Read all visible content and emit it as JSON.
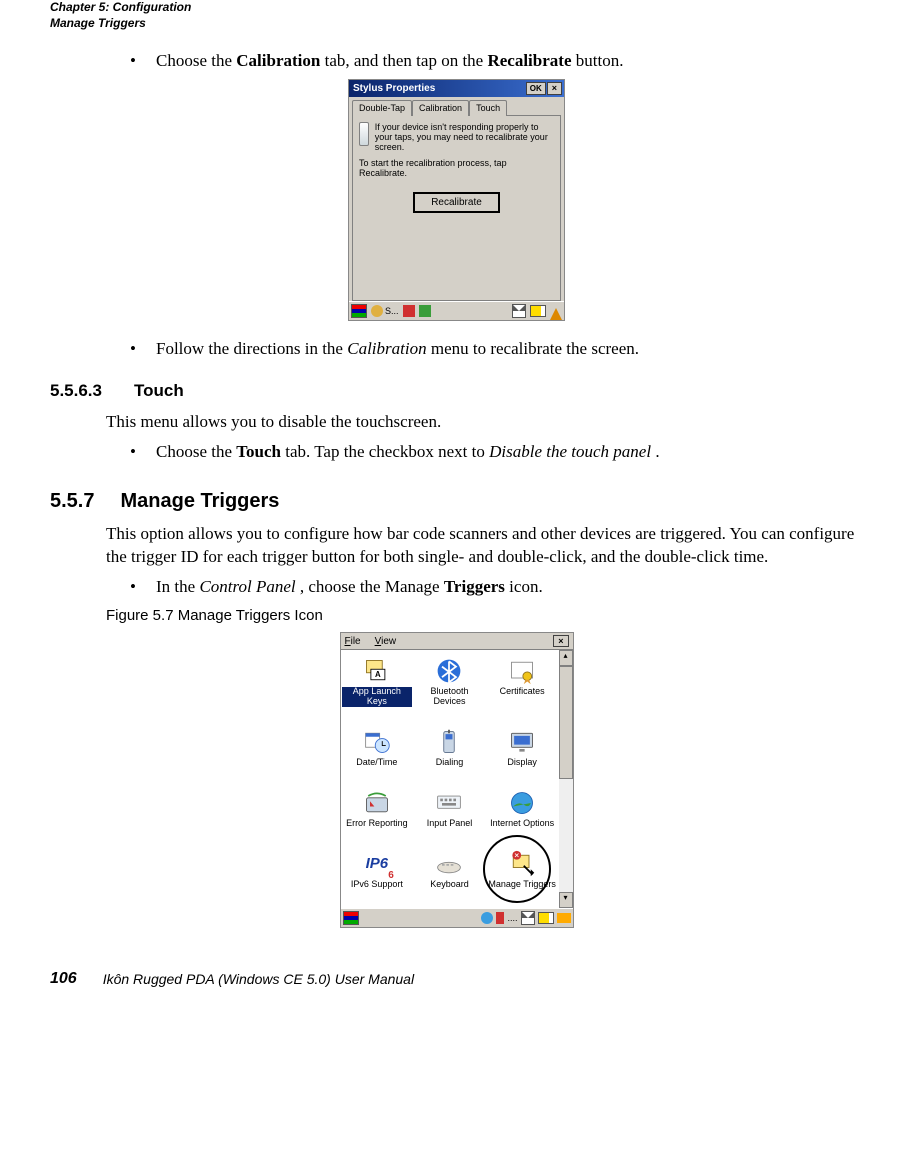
{
  "header": {
    "line1": "Chapter 5: Configuration",
    "line2": "Manage Triggers"
  },
  "bullet1_pre": "Choose the ",
  "bullet1_b1": "Calibration",
  "bullet1_mid": " tab, and then tap on the ",
  "bullet1_b2": "Recalibrate",
  "bullet1_post": " button.",
  "stylus": {
    "title": "Stylus Properties",
    "ok": "OK",
    "close": "×",
    "tab1": "Double-Tap",
    "tab2": "Calibration",
    "tab3": "Touch",
    "msg1": "If your device isn't responding properly to your taps, you may need to recalibrate your screen.",
    "msg2": "To start the recalibration process, tap Recalibrate.",
    "btn": "Recalibrate",
    "task_s": "S..."
  },
  "bullet2_pre": "Follow the directions in the ",
  "bullet2_em": "Calibration",
  "bullet2_post": " menu to recalibrate the screen.",
  "sec5563": {
    "num": "5.5.6.3",
    "title": "Touch"
  },
  "touch_body": "This menu allows you to disable the touchscreen.",
  "bullet3_pre": "Choose the ",
  "bullet3_b": "Touch",
  "bullet3_mid": " tab. Tap the checkbox next to ",
  "bullet3_em": "Disable the touch panel",
  "bullet3_post": ".",
  "sec557": {
    "num": "5.5.7",
    "title": "Manage Triggers"
  },
  "mt_body": "This option allows you to configure how bar code scanners and other devices are triggered. You can configure the trigger ID for each trigger button for both single- and double-click, and the double-click time.",
  "bullet4_pre": "In the ",
  "bullet4_em": "Control Panel",
  "bullet4_mid": ", choose the Manage ",
  "bullet4_b": "Triggers",
  "bullet4_post": " icon.",
  "figcap": "Figure 5.7  Manage Triggers Icon",
  "cp": {
    "file": "File",
    "view": "View",
    "close": "×",
    "items": [
      {
        "label": "App Launch Keys"
      },
      {
        "label": "Bluetooth Devices"
      },
      {
        "label": "Certificates"
      },
      {
        "label": "Date/Time"
      },
      {
        "label": "Dialing"
      },
      {
        "label": "Display"
      },
      {
        "label": "Error Reporting"
      },
      {
        "label": "Input Panel"
      },
      {
        "label": "Internet Options"
      },
      {
        "label": "IPv6 Support"
      },
      {
        "label": "Keyboard"
      },
      {
        "label": "Manage Triggers"
      }
    ],
    "ip6": "IP6",
    "up": "▴",
    "down": "▾"
  },
  "footer": {
    "page": "106",
    "text": "Ikôn Rugged PDA (Windows CE 5.0) User Manual"
  }
}
